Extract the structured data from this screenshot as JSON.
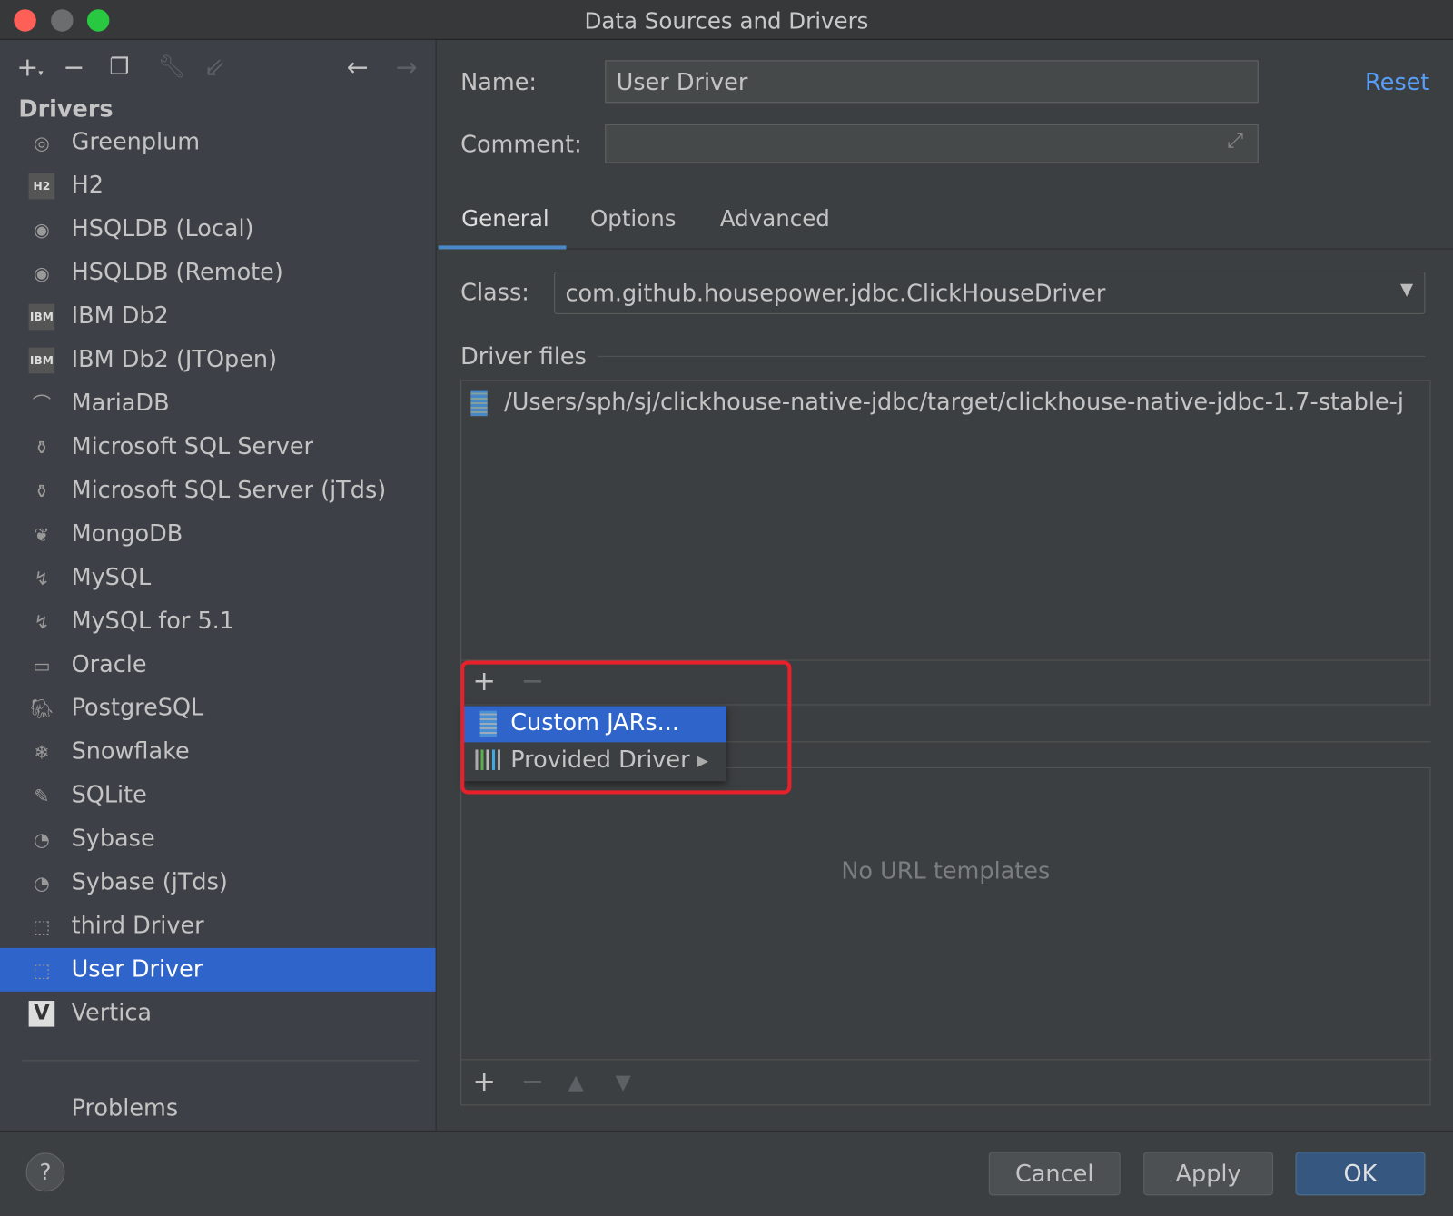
{
  "window": {
    "title": "Data Sources and Drivers"
  },
  "toolbar": {
    "icons": [
      "plus-dropdown-icon",
      "minus-icon",
      "duplicate-icon",
      "wrench-icon",
      "import-icon",
      "back-arrow-icon",
      "forward-arrow-icon"
    ]
  },
  "sidebar": {
    "heading": "Drivers",
    "items": [
      {
        "label": "Greenplum",
        "icon": "greenplum-icon"
      },
      {
        "label": "H2",
        "icon": "h2-icon"
      },
      {
        "label": "HSQLDB (Local)",
        "icon": "hsqldb-icon"
      },
      {
        "label": "HSQLDB (Remote)",
        "icon": "hsqldb-icon"
      },
      {
        "label": "IBM Db2",
        "icon": "ibm-db2-icon"
      },
      {
        "label": "IBM Db2 (JTOpen)",
        "icon": "ibm-db2-icon"
      },
      {
        "label": "MariaDB",
        "icon": "mariadb-icon"
      },
      {
        "label": "Microsoft SQL Server",
        "icon": "mssql-icon"
      },
      {
        "label": "Microsoft SQL Server (jTds)",
        "icon": "mssql-icon"
      },
      {
        "label": "MongoDB",
        "icon": "mongodb-icon"
      },
      {
        "label": "MySQL",
        "icon": "mysql-icon"
      },
      {
        "label": "MySQL for 5.1",
        "icon": "mysql-icon"
      },
      {
        "label": "Oracle",
        "icon": "oracle-icon"
      },
      {
        "label": "PostgreSQL",
        "icon": "postgresql-icon"
      },
      {
        "label": "Snowflake",
        "icon": "snowflake-icon"
      },
      {
        "label": "SQLite",
        "icon": "sqlite-icon"
      },
      {
        "label": "Sybase",
        "icon": "sybase-icon"
      },
      {
        "label": "Sybase (jTds)",
        "icon": "sybase-icon"
      },
      {
        "label": "third Driver",
        "icon": "user-driver-icon"
      },
      {
        "label": "User Driver",
        "icon": "user-driver-icon",
        "selected": true
      },
      {
        "label": "Vertica",
        "icon": "vertica-icon"
      }
    ],
    "problems": "Problems"
  },
  "form": {
    "name_label": "Name:",
    "name_value": "User Driver",
    "reset": "Reset",
    "comment_label": "Comment:",
    "comment_value": ""
  },
  "tabs": [
    {
      "label": "General",
      "active": true
    },
    {
      "label": "Options"
    },
    {
      "label": "Advanced"
    }
  ],
  "general": {
    "class_label": "Class:",
    "class_value": "com.github.housepower.jdbc.ClickHouseDriver",
    "driver_files_label": "Driver files",
    "driver_files": [
      "/Users/sph/sj/clickhouse-native-jdbc/target/clickhouse-native-jdbc-1.7-stable-j"
    ],
    "popup": [
      {
        "label": "Custom JARs...",
        "selected": true
      },
      {
        "label": "Provided Driver",
        "submenu": true
      }
    ],
    "url_templates_empty": "No URL templates"
  },
  "buttons": {
    "help": "?",
    "cancel": "Cancel",
    "apply": "Apply",
    "ok": "OK"
  },
  "colors": {
    "selection": "#2f65ca",
    "link": "#589df6",
    "highlight": "#e8202a"
  }
}
